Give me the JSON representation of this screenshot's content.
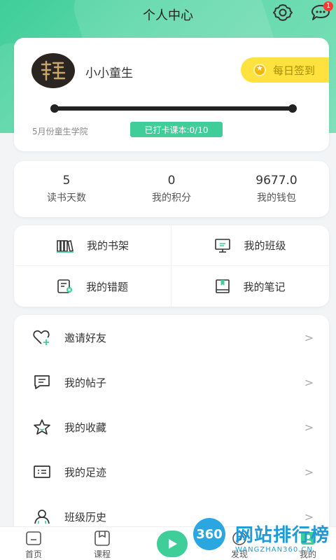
{
  "header": {
    "title": "个人中心",
    "notification_count": "1",
    "settings_icon": "gear-icon",
    "message_icon": "chat-bubble-icon"
  },
  "profile": {
    "username": "小小童生",
    "signin_label": "每日签到",
    "college": "5月份童生学院",
    "checkin_label": "已打卡课本:0/10",
    "checkin_progress": 0
  },
  "stats": [
    {
      "value": "5",
      "label": "读书天数"
    },
    {
      "value": "0",
      "label": "我的积分"
    },
    {
      "value": "9677.0",
      "label": "我的钱包"
    }
  ],
  "grid": [
    {
      "label": "我的书架",
      "icon": "bookshelf-icon"
    },
    {
      "label": "我的班级",
      "icon": "class-board-icon"
    },
    {
      "label": "我的错题",
      "icon": "mistakes-icon"
    },
    {
      "label": "我的笔记",
      "icon": "notebook-icon"
    }
  ],
  "menu": [
    {
      "label": "邀请好友",
      "icon": "heart-plus-icon"
    },
    {
      "label": "我的帖子",
      "icon": "post-icon"
    },
    {
      "label": "我的收藏",
      "icon": "star-icon"
    },
    {
      "label": "我的足迹",
      "icon": "footprint-icon"
    },
    {
      "label": "班级历史",
      "icon": "class-history-icon"
    }
  ],
  "tabbar": [
    {
      "label": "首页",
      "icon": "home-icon"
    },
    {
      "label": "课程",
      "icon": "course-icon"
    },
    {
      "label": "发现",
      "icon": "discover-icon"
    },
    {
      "label": "我的",
      "icon": "profile-icon"
    }
  ],
  "watermark": {
    "badge": "360",
    "name": "网站排行榜",
    "sub": "WANGZHAN360.CN"
  },
  "colors": {
    "accent": "#3fce9a",
    "signin": "#ffe23e",
    "badge": "#ff3b30"
  }
}
